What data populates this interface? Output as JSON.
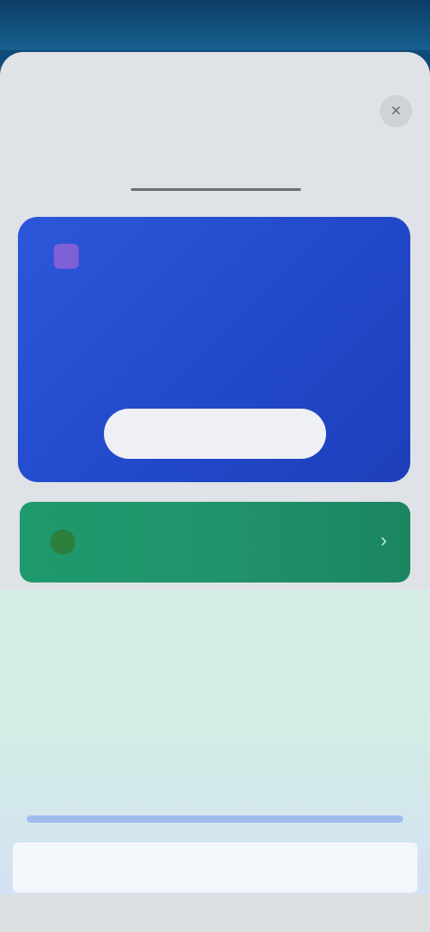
{
  "status_bar": {
    "time": "",
    "icons": ""
  },
  "sheet": {
    "title": "",
    "close_glyph": "×",
    "tabs": [
      {
        "label": ""
      },
      {
        "label": ""
      },
      {
        "label": ""
      }
    ]
  },
  "promo": {
    "logo_glyph": "",
    "title": "",
    "description": "",
    "button_label": ""
  },
  "green_banner": {
    "icon_glyph": "",
    "text": "",
    "chevron": "›"
  },
  "links": [
    {
      "label": ""
    },
    {
      "label": ""
    },
    {
      "label": ""
    }
  ],
  "bottom": {
    "link_label": ""
  },
  "colors": {
    "promo_blue": "#2148c9",
    "banner_green": "#20926a",
    "link_blue": "#7fb2ea"
  }
}
